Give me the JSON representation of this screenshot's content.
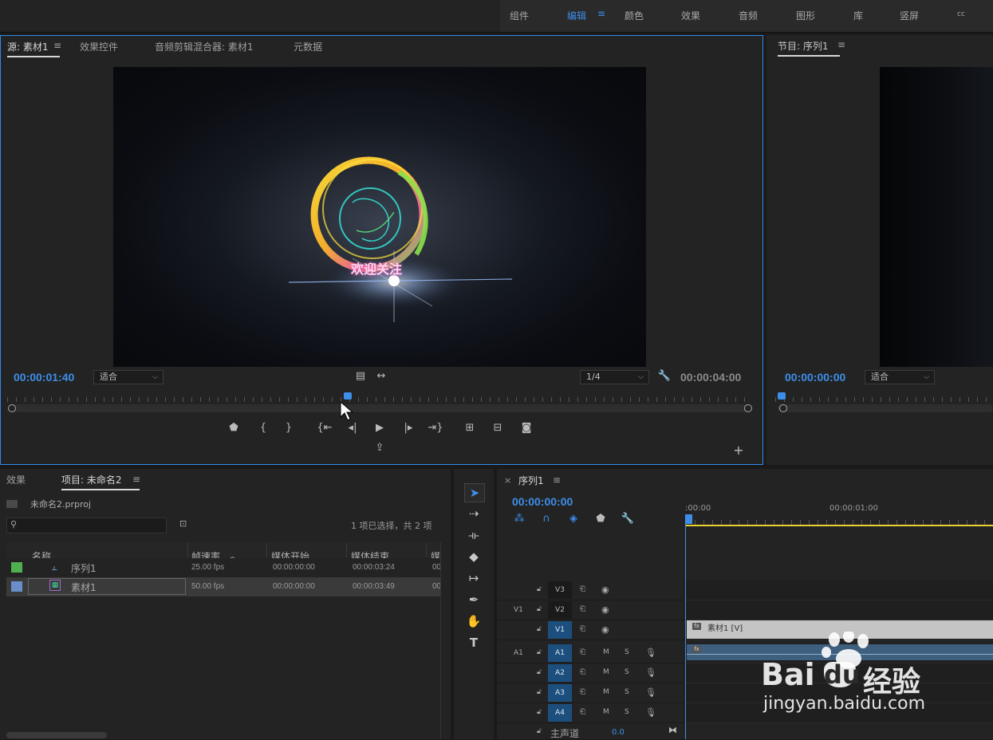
{
  "workspaces": {
    "tabs": [
      {
        "label": "组件",
        "active": false
      },
      {
        "label": "编辑",
        "active": true
      },
      {
        "label": "颜色",
        "active": false
      },
      {
        "label": "效果",
        "active": false
      },
      {
        "label": "音频",
        "active": false
      },
      {
        "label": "图形",
        "active": false
      },
      {
        "label": "库",
        "active": false
      },
      {
        "label": "竖屏",
        "active": false
      },
      {
        "label": "cc",
        "active": false
      }
    ],
    "menu_icon": "hamburger-icon"
  },
  "source": {
    "tabs": [
      {
        "label": "源: 素材1",
        "active": true
      },
      {
        "label": "效果控件",
        "active": false
      },
      {
        "label": "音频剪辑混合器: 素材1",
        "active": false
      },
      {
        "label": "元数据",
        "active": false
      }
    ],
    "video_overlay_text": "欢迎关注",
    "playhead_timecode": "00:00:01:40",
    "zoom": "适合",
    "resolution": "1/4",
    "duration": "00:00:04:00",
    "playhead_position": 0.457
  },
  "program": {
    "title": "节目: 序列1",
    "timecode": "00:00:00:00",
    "zoom": "适合"
  },
  "project": {
    "tabs": [
      {
        "label": "效果",
        "active": false
      },
      {
        "label": "项目: 未命名2",
        "active": true
      }
    ],
    "file": "未命名2.prproj",
    "search_placeholder": "",
    "selection_status": "1 项已选择，共 2 项",
    "columns": [
      "名称",
      "帧速率",
      "媒体开始",
      "媒体结束",
      "媒"
    ],
    "rows": [
      {
        "color": "#4fb04f",
        "icon": "sequence-icon",
        "name": "序列1",
        "fps": "25.00 fps",
        "start": "00:00:00:00",
        "end": "00:00:03:24",
        "extra": "00",
        "selected": false
      },
      {
        "color": "#6a8fc8",
        "icon": "clip-icon",
        "name": "素材1",
        "fps": "50.00 fps",
        "start": "00:00:00:00",
        "end": "00:00:03:49",
        "extra": "00",
        "selected": true
      }
    ]
  },
  "timeline": {
    "title": "序列1",
    "close": "×",
    "timecode": "00:00:00:00",
    "ruler": [
      ":00:00",
      "00:00:01:00"
    ],
    "tracks": [
      {
        "label": "V3",
        "src": "",
        "on": false,
        "kind": "video"
      },
      {
        "label": "V2",
        "src": "V1",
        "on": false,
        "kind": "video"
      },
      {
        "label": "V1",
        "src": "",
        "on": true,
        "kind": "video"
      },
      {
        "label": "A1",
        "src": "A1",
        "on": true,
        "kind": "audio"
      },
      {
        "label": "A2",
        "src": "",
        "on": true,
        "kind": "audio"
      },
      {
        "label": "A3",
        "src": "",
        "on": true,
        "kind": "audio"
      },
      {
        "label": "A4",
        "src": "",
        "on": true,
        "kind": "audio"
      }
    ],
    "mute_label": "M",
    "solo_label": "S",
    "master_label": "主声道",
    "master_value": "0.0",
    "clip_label": "素材1 [V]"
  },
  "watermark": {
    "brand": "Bai",
    "brand_tail": "经验",
    "url": "jingyan.baidu.com"
  }
}
